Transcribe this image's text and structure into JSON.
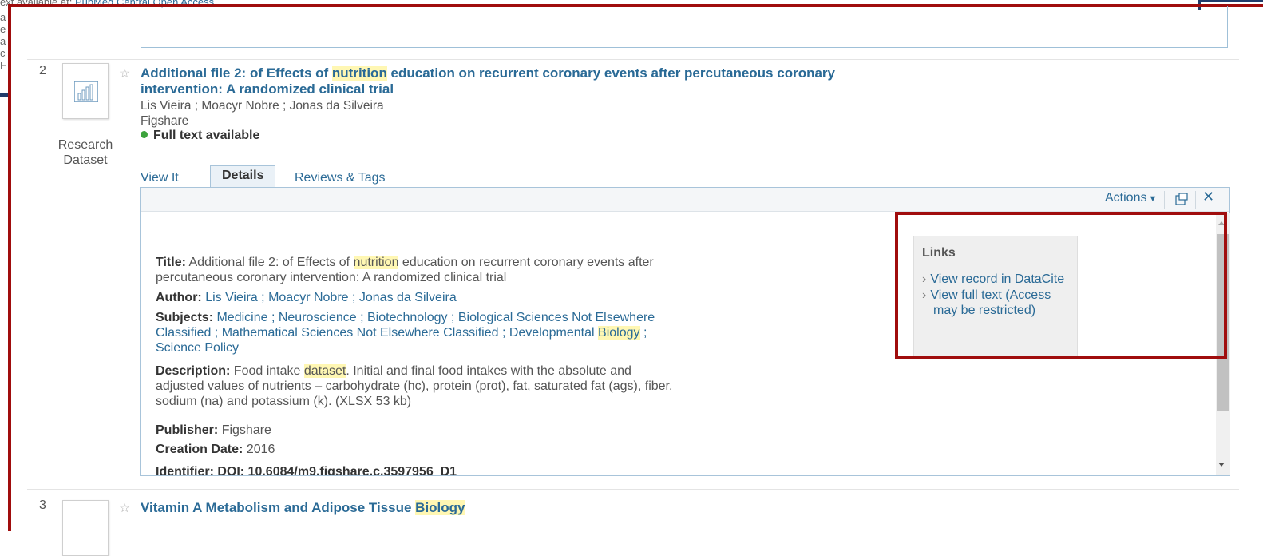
{
  "background": {
    "top_text": "ext available at: ",
    "top_link": "PubMed Central Open Access",
    "left_column_letters": [
      "a",
      "e",
      "a",
      "c",
      "F"
    ]
  },
  "record2": {
    "number": "2",
    "type_line1": "Research",
    "type_line2": "Dataset",
    "title_pre": "Additional file 2: of Effects of ",
    "title_hl": "nutrition",
    "title_post": " education on recurrent coronary events after percutaneous coronary",
    "title_line2": "intervention: A randomized clinical trial",
    "authors": "Lis Vieira ; Moacyr Nobre ; Jonas da Silveira",
    "source": "Figshare",
    "availability": "Full text available",
    "availability_color": "#3ca33c",
    "tabs": [
      "View It",
      "Details",
      "Reviews & Tags"
    ],
    "actions_label": "Actions",
    "details": {
      "title_label": "Title:",
      "title_pre": "Additional file 2: of Effects of ",
      "title_hl": "nutrition",
      "title_post": " education on recurrent coronary events after",
      "title_line2": "percutaneous coronary intervention: A randomized clinical trial",
      "author_label": "Author:",
      "author_value": "Lis Vieira ; Moacyr Nobre ; Jonas da Silveira",
      "subjects_label": "Subjects:",
      "subjects_line1": "Medicine ; Neuroscience ; Biotechnology ; Biological Sciences Not Elsewhere",
      "subjects_line2_pre": "Classified ; Mathematical Sciences Not Elsewhere Classified ; Developmental ",
      "subjects_line2_hl": "Biology",
      "subjects_line2_post": " ;",
      "subjects_line3": "Science Policy",
      "description_label": "Description:",
      "description_pre": "Food intake ",
      "description_hl": "dataset",
      "description_post": ". Initial and final food intakes with the absolute and",
      "description_line2": "adjusted values of nutrients – carbohydrate (hc), protein (prot), fat, saturated fat (ags), fiber,",
      "description_line3": "sodium (na) and potassium (k). (XLSX 53 kb)",
      "publisher_label": "Publisher:",
      "publisher_value": "Figshare",
      "creation_label": "Creation Date:",
      "creation_value": "2016",
      "identifier_partial": "Identifier:  DOI: 10.6084/m9.figshare.c.3597956_D1"
    },
    "links": {
      "title": "Links",
      "items": [
        "View record in DataCite",
        "View full text (Access may be restricted)"
      ]
    }
  },
  "record3": {
    "number": "3",
    "title_pre": "Vitamin A Metabolism and Adipose Tissue ",
    "title_hl": "Biology"
  },
  "colors": {
    "accent_link": "#2a6a96",
    "highlight": "#fff7b3",
    "emphasis_frame": "#a00d0d"
  }
}
